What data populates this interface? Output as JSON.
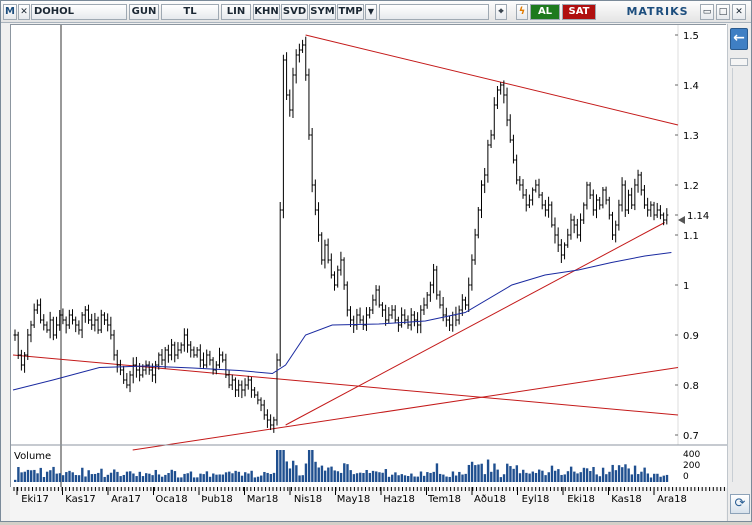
{
  "toolbar": {
    "m_label": "M",
    "symbol": "DOHOL",
    "period": "GUN",
    "currency": "TL",
    "scale": "LIN",
    "khn_label": "KHN",
    "svd_label": "SVD",
    "sym_label": "SYM",
    "tmp_label": "TMP",
    "buy_label": "AL",
    "sell_label": "SAT",
    "brand": "MATRIKS",
    "colors": {
      "buy": "#1e7a1e",
      "sell": "#b01010",
      "brand": "#1d4e7e"
    }
  },
  "chart_data": {
    "type": "candlestick",
    "symbol": "DOHOL",
    "y_axis_labels": [
      "1.5",
      "1.4",
      "1.3",
      "1.2",
      "1.14",
      "1.1",
      "1",
      "0.9",
      "0.8",
      "0.7"
    ],
    "ylim": [
      0.68,
      1.52
    ],
    "last_price": 1.14,
    "x_axis_labels": [
      "Eki17",
      "Kas17",
      "Ara17",
      "Oca18",
      "Þub18",
      "Mar18",
      "Nis18",
      "May18",
      "Haz18",
      "Tem18",
      "Aðu18",
      "Eyl18",
      "Eki18",
      "Kas18",
      "Ara18"
    ],
    "close_series": [
      0.9,
      0.86,
      0.84,
      0.86,
      0.9,
      0.92,
      0.95,
      0.96,
      0.93,
      0.92,
      0.91,
      0.93,
      0.9,
      0.92,
      0.94,
      0.93,
      0.92,
      0.94,
      0.93,
      0.92,
      0.91,
      0.94,
      0.95,
      0.93,
      0.92,
      0.93,
      0.91,
      0.94,
      0.93,
      0.92,
      0.9,
      0.86,
      0.84,
      0.83,
      0.81,
      0.8,
      0.82,
      0.84,
      0.83,
      0.82,
      0.83,
      0.84,
      0.83,
      0.82,
      0.84,
      0.86,
      0.85,
      0.87,
      0.86,
      0.88,
      0.86,
      0.87,
      0.88,
      0.9,
      0.88,
      0.87,
      0.86,
      0.87,
      0.85,
      0.84,
      0.86,
      0.85,
      0.83,
      0.84,
      0.86,
      0.85,
      0.82,
      0.8,
      0.81,
      0.79,
      0.8,
      0.79,
      0.8,
      0.81,
      0.79,
      0.78,
      0.77,
      0.76,
      0.74,
      0.73,
      0.72,
      0.73,
      0.85,
      1.15,
      1.45,
      1.38,
      1.35,
      1.42,
      1.46,
      1.47,
      1.48,
      1.42,
      1.3,
      1.2,
      1.15,
      1.1,
      1.05,
      1.08,
      1.05,
      1.02,
      1.0,
      1.03,
      1.05,
      1.0,
      0.95,
      0.93,
      0.92,
      0.94,
      0.93,
      0.92,
      0.94,
      0.95,
      0.97,
      0.99,
      0.96,
      0.95,
      0.93,
      0.94,
      0.95,
      0.93,
      0.92,
      0.94,
      0.93,
      0.92,
      0.94,
      0.93,
      0.92,
      0.95,
      0.96,
      0.98,
      1.0,
      1.03,
      0.98,
      0.96,
      0.94,
      0.93,
      0.92,
      0.94,
      0.93,
      0.95,
      0.97,
      0.96,
      1.0,
      1.05,
      1.1,
      1.15,
      1.2,
      1.22,
      1.28,
      1.3,
      1.36,
      1.39,
      1.4,
      1.38,
      1.33,
      1.29,
      1.25,
      1.21,
      1.2,
      1.18,
      1.16,
      1.17,
      1.19,
      1.2,
      1.18,
      1.16,
      1.15,
      1.16,
      1.12,
      1.1,
      1.08,
      1.06,
      1.08,
      1.1,
      1.13,
      1.12,
      1.1,
      1.13,
      1.16,
      1.2,
      1.18,
      1.15,
      1.17,
      1.16,
      1.19,
      1.17,
      1.14,
      1.1,
      1.12,
      1.16,
      1.2,
      1.15,
      1.18,
      1.16,
      1.2,
      1.22,
      1.19,
      1.16,
      1.15,
      1.16,
      1.14,
      1.15,
      1.14,
      1.13,
      1.14
    ],
    "moving_average": [
      [
        0,
        0.79
      ],
      [
        0.06,
        0.81
      ],
      [
        0.13,
        0.835
      ],
      [
        0.2,
        0.838
      ],
      [
        0.27,
        0.834
      ],
      [
        0.34,
        0.829
      ],
      [
        0.39,
        0.823
      ],
      [
        0.41,
        0.84
      ],
      [
        0.44,
        0.9
      ],
      [
        0.48,
        0.92
      ],
      [
        0.55,
        0.922
      ],
      [
        0.62,
        0.928
      ],
      [
        0.68,
        0.945
      ],
      [
        0.75,
        1.0
      ],
      [
        0.8,
        1.02
      ],
      [
        0.85,
        1.03
      ],
      [
        0.9,
        1.045
      ],
      [
        0.95,
        1.058
      ],
      [
        0.99,
        1.065
      ]
    ],
    "trendlines": [
      {
        "from": [
          0.0,
          0.86
        ],
        "to": [
          1.0,
          0.74
        ]
      },
      {
        "from": [
          0.18,
          0.67
        ],
        "to": [
          1.0,
          0.835
        ]
      },
      {
        "from": [
          0.41,
          0.72
        ],
        "to": [
          0.98,
          1.125
        ]
      },
      {
        "from": [
          0.44,
          1.5
        ],
        "to": [
          1.0,
          1.32
        ]
      }
    ],
    "volume_label": "Volume",
    "volume_axis_labels": [
      "400",
      "200",
      "0"
    ],
    "grid": false
  },
  "right_panel": {
    "collapse_icon": "arrow-left-icon",
    "settings_icon": "refresh-icon"
  }
}
